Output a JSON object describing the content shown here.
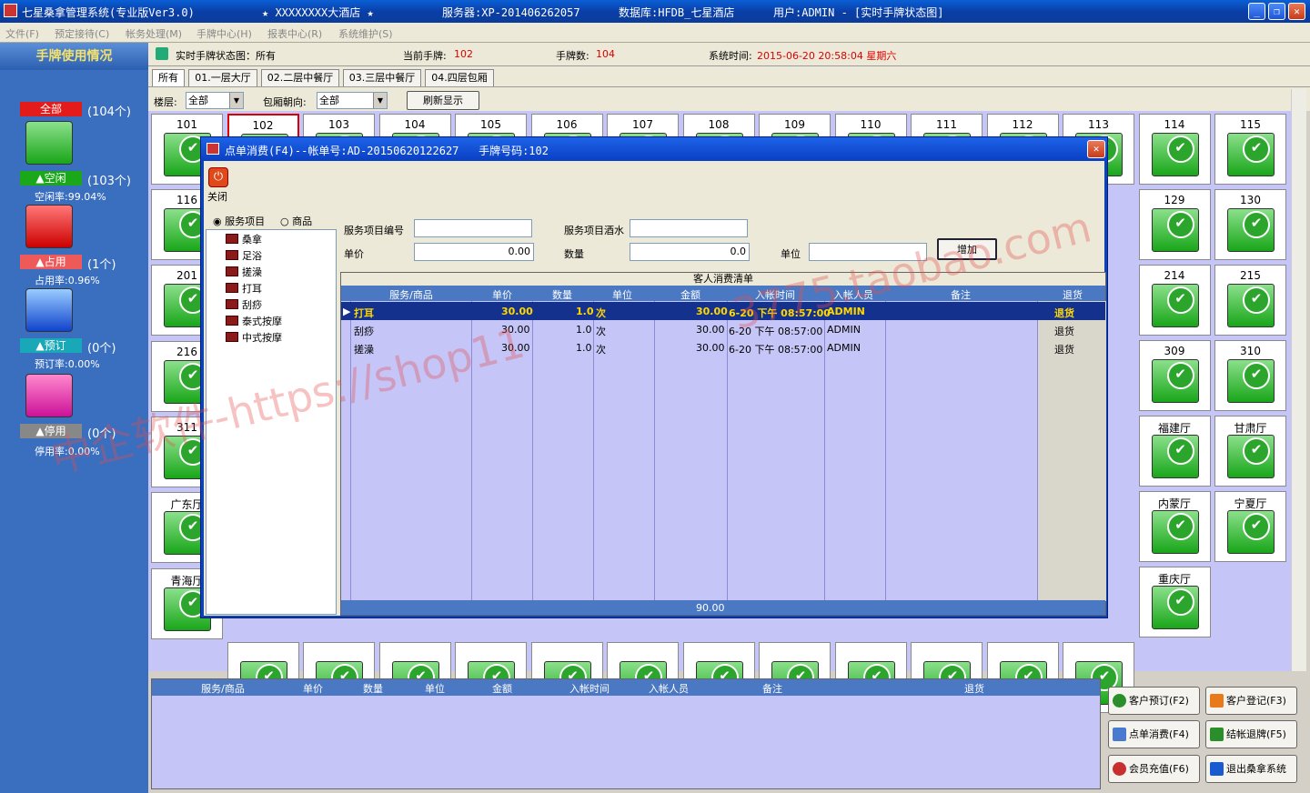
{
  "window": {
    "title": "七星桑拿管理系统(专业版Ver3.0)",
    "hotel": "★ XXXXXXXX大酒店 ★",
    "server": "服务器:XP-201406262057",
    "database": "数据库:HFDB_七星酒店",
    "user": "用户:ADMIN - [实时手牌状态图]",
    "min": "_",
    "max": "❐",
    "close": "✕"
  },
  "menu": [
    "文件(F)",
    "预定接待(C)",
    "帐务处理(M)",
    "手牌中心(H)",
    "报表中心(R)",
    "系统维护(S)"
  ],
  "left": {
    "header": "手牌使用情况",
    "all_label": "全部",
    "all_count": "(104个)",
    "idle_label": "▲空闲",
    "idle_count": "(103个)",
    "idle_rate": "空闲率:99.04%",
    "used_label": "▲占用",
    "used_count": "(1个)",
    "used_rate": "占用率:0.96%",
    "booked_label": "▲预订",
    "booked_count": "(0个)",
    "booked_rate": "预订率:0.00%",
    "stopped_label": "▲停用",
    "stopped_count": "(0个)",
    "stopped_rate": "停用率:0.00%"
  },
  "header": {
    "status": "实时手牌状态图：所有",
    "current_label": "当前手牌:",
    "current_value": "102",
    "count_label": "手牌数:",
    "count_value": "104",
    "time_label": "系统时间:",
    "time_value": "2015-06-20 20:58:04 星期六"
  },
  "tabs": [
    "所有",
    "01.一层大厅",
    "02.二层中餐厅",
    "03.三层中餐厅",
    "04.四层包厢"
  ],
  "filter": {
    "floor_label": "楼层:",
    "floor_value": "全部",
    "direction_label": "包厢朝向:",
    "direction_value": "全部",
    "refresh": "刷新显示"
  },
  "rooms": {
    "row1": [
      "101",
      "102",
      "103",
      "104",
      "105",
      "106",
      "107",
      "108",
      "109",
      "110",
      "111",
      "112",
      "113",
      "114",
      "115"
    ],
    "col1": [
      "116",
      "201",
      "216",
      "311",
      "广东厅",
      "青海厅"
    ],
    "right": [
      "129",
      "130",
      "214",
      "215",
      "309",
      "310",
      "福建厅",
      "甘肃厅",
      "内蒙厅",
      "宁夏厅",
      "重庆厅"
    ]
  },
  "bottom": {
    "columns": [
      "服务/商品",
      "单价",
      "数量",
      "单位",
      "金额",
      "入帐时间",
      "入帐人员",
      "备注",
      "退货"
    ],
    "buttons": [
      "客户预订(F2)",
      "客户登记(F3)",
      "点单消费(F4)",
      "结帐退牌(F5)",
      "会员充值(F6)",
      "退出桑拿系统"
    ]
  },
  "dialog": {
    "title": "点单消费(F4)--帐单号:AD-20150620122627   手牌号码:102",
    "close_label": "关闭",
    "radio_service": "服务项目",
    "radio_goods": "商品",
    "tree": [
      "桑拿",
      "足浴",
      "搓澡",
      "打耳",
      "刮痧",
      "泰式按摩",
      "中式按摩"
    ],
    "code_label": "服务项目编号",
    "water_label": "服务项目酒水",
    "price_label": "单价",
    "price_value": "0.00",
    "qty_label": "数量",
    "qty_value": "0.0",
    "unit_label": "单位",
    "add_button": "增加",
    "grid_title": "客人消费清单",
    "columns": [
      "服务/商品",
      "单价",
      "数量",
      "单位",
      "金额",
      "入帐时间",
      "入帐人员",
      "备注",
      "退货"
    ],
    "rows": [
      {
        "item": "打耳",
        "price": "30.00",
        "qty": "1.0",
        "unit": "次",
        "amount": "30.00",
        "time": "6-20 下午 08:57:00",
        "staff": "ADMIN",
        "note": "",
        "ret": "退货"
      },
      {
        "item": "刮痧",
        "price": "30.00",
        "qty": "1.0",
        "unit": "次",
        "amount": "30.00",
        "time": "6-20 下午 08:57:00",
        "staff": "ADMIN",
        "note": "",
        "ret": "退货"
      },
      {
        "item": "搓澡",
        "price": "30.00",
        "qty": "1.0",
        "unit": "次",
        "amount": "30.00",
        "time": "6-20 下午 08:57:00",
        "staff": "ADMIN",
        "note": "",
        "ret": "退货"
      }
    ],
    "total": "90.00"
  },
  "watermark": {
    "text1": "中企软件-https://shop11",
    "text2": "3775.taobao.com"
  },
  "colors": {
    "accent": "#0b43b8",
    "grid_header": "#4b78c2",
    "grid_bg": "#c5c5f7",
    "selected_row": "#15318e"
  }
}
